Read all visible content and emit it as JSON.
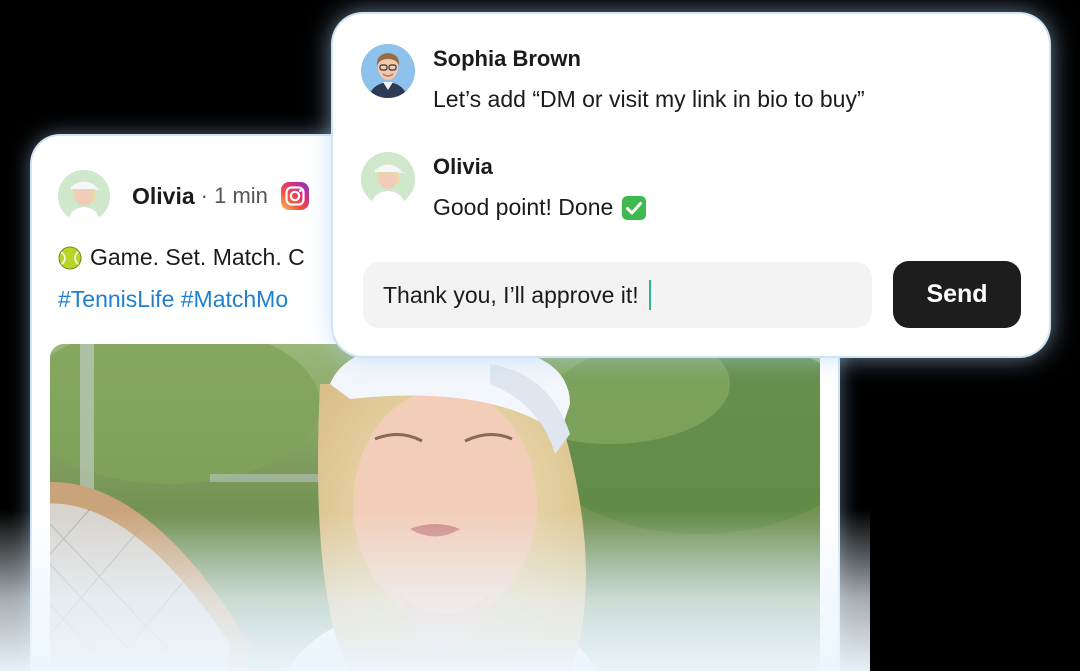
{
  "post": {
    "author": "Olivia",
    "meta": "· 1 min",
    "platform_icon": "instagram-icon",
    "caption": "Game. Set. Match. C",
    "caption_icon": "tennis-ball-icon",
    "hashtags": "#TennisLife #MatchMo"
  },
  "chat": {
    "messages": [
      {
        "name": "Sophia Brown",
        "text": "Let’s add “DM or visit my link in bio to buy”"
      },
      {
        "name": "Olivia",
        "text": "Good point! Done",
        "emoji_icon": "check-mark-icon"
      }
    ],
    "reply_value": "Thank you, I’ll approve it!",
    "send_label": "Send"
  },
  "colors": {
    "hashtag": "#1f7fd1",
    "send_button": "#1d1d1d",
    "card_glow": "#cfe3f6",
    "caret": "#2bb596"
  }
}
